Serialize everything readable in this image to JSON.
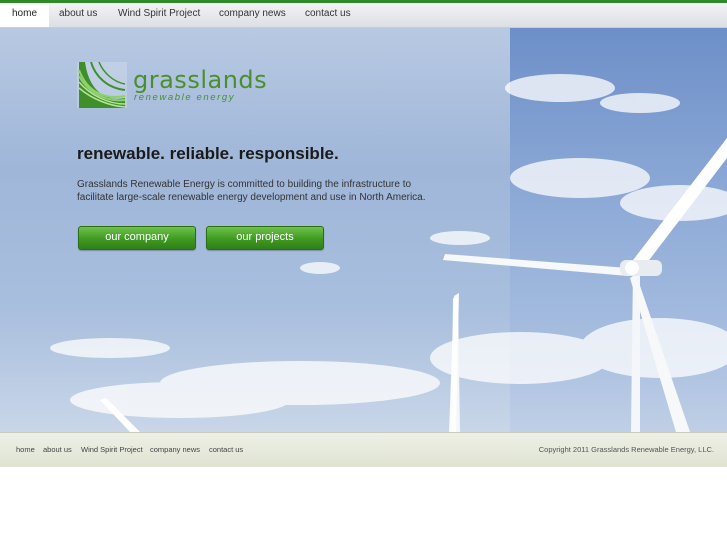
{
  "nav": {
    "items": [
      {
        "label": "home"
      },
      {
        "label": "about us"
      },
      {
        "label": "Wind Spirit Project"
      },
      {
        "label": "company news"
      },
      {
        "label": "contact us"
      }
    ]
  },
  "brand": {
    "name": "grasslands",
    "tagline": "renewable energy",
    "color": "#4a8f2e"
  },
  "hero": {
    "headline": "renewable. reliable. responsible.",
    "intro": "Grasslands Renewable Energy is committed to building the infrastructure to facilitate large-scale renewable energy development and use in North America.",
    "buttons": [
      {
        "label": "our company"
      },
      {
        "label": "our projects"
      }
    ]
  },
  "footer": {
    "links": [
      {
        "label": "home"
      },
      {
        "label": "about us"
      },
      {
        "label": "Wind Spirit Project"
      },
      {
        "label": "company news"
      },
      {
        "label": "contact us"
      }
    ],
    "copyright": "Copyright 2011 Grasslands Renewable Energy, LLC."
  }
}
